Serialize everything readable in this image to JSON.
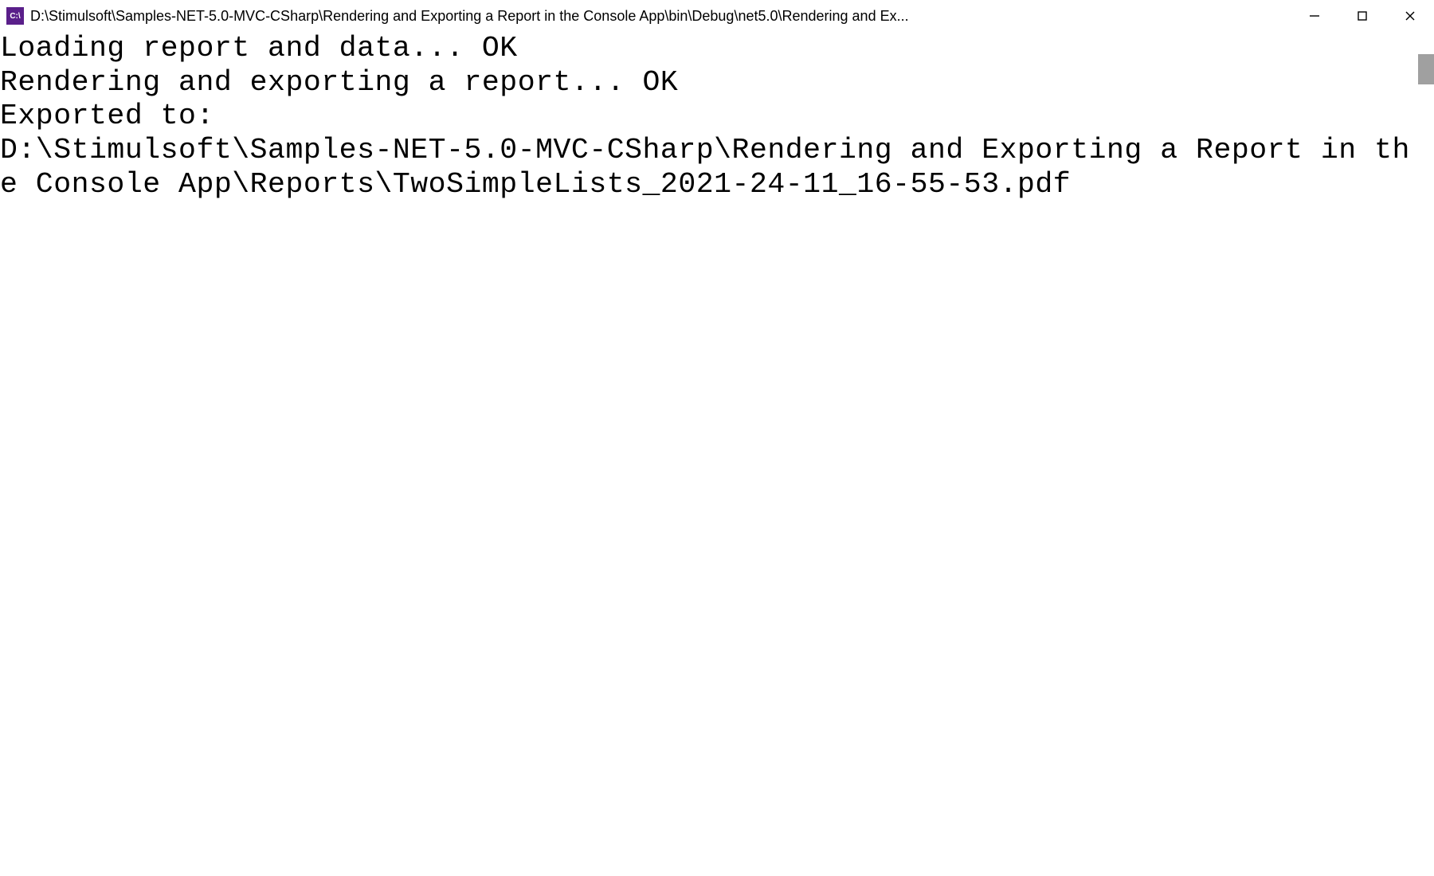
{
  "titlebar": {
    "icon_label": "C:\\",
    "title": "D:\\Stimulsoft\\Samples-NET-5.0-MVC-CSharp\\Rendering and Exporting a Report in the Console App\\bin\\Debug\\net5.0\\Rendering and Ex..."
  },
  "console": {
    "lines": [
      "Loading report and data... OK",
      "Rendering and exporting a report... OK",
      "Exported to:",
      "D:\\Stimulsoft\\Samples-NET-5.0-MVC-CSharp\\Rendering and Exporting a Report in the Console App\\Reports\\TwoSimpleLists_2021-24-11_16-55-53.pdf"
    ]
  }
}
